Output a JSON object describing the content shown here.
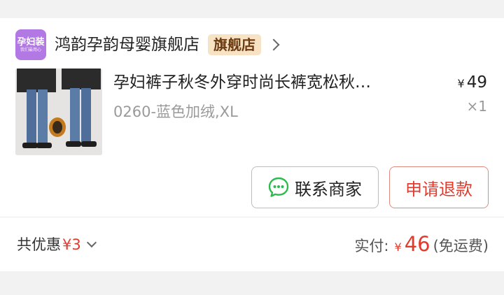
{
  "shop": {
    "logo_main": "孕妇装",
    "logo_sub": "我们最用心",
    "name": "鸿韵孕韵母婴旗舰店",
    "badge": "旗舰店"
  },
  "item": {
    "title": "孕妇裤子秋冬外穿时尚长裤宽松秋…",
    "sku": "0260-蓝色加绒,XL",
    "currency": "¥",
    "price": "49",
    "quantity": "×1"
  },
  "actions": {
    "contact_label": "联系商家",
    "refund_label": "申请退款"
  },
  "summary": {
    "promo_label": "共优惠",
    "promo_amount": "¥3",
    "paid_label": "实付:",
    "paid_currency": "¥",
    "paid_amount": "46",
    "shipping_note": "(免运费)"
  },
  "colors": {
    "accent_red": "#e23b2e",
    "badge_bg": "#f7e2c4",
    "chat_green": "#2dbb4e"
  }
}
